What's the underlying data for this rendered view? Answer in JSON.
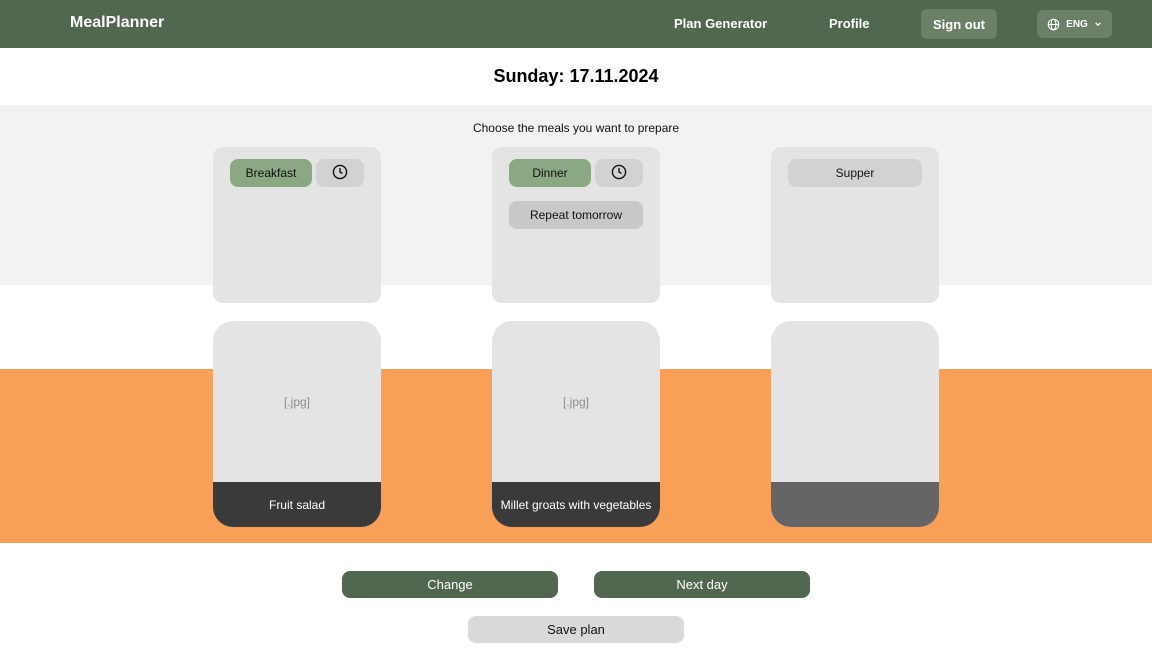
{
  "nav": {
    "logo": "MealPlanner",
    "plan_generator": "Plan Generator",
    "profile": "Profile",
    "sign_out": "Sign out",
    "language": "ENG",
    "language_icon": "globe-icon",
    "language_chevron": "chevron-down-icon"
  },
  "day": {
    "title": "Sunday: 17.11.2024",
    "instruction": "Choose the meals you want to prepare"
  },
  "meals": [
    {
      "label": "Breakfast",
      "active": true,
      "has_time": true,
      "time_icon": "clock-icon",
      "repeat_label": null,
      "image_placeholder": "[.jpg]",
      "dish": "Fruit salad"
    },
    {
      "label": "Dinner",
      "active": true,
      "has_time": true,
      "time_icon": "clock-icon",
      "repeat_label": "Repeat tomorrow",
      "image_placeholder": "[.jpg]",
      "dish": "Millet groats with vegetables"
    },
    {
      "label": "Supper",
      "active": false,
      "has_time": false,
      "repeat_label": null,
      "image_placeholder": "",
      "dish": ""
    }
  ],
  "actions": {
    "change": "Change",
    "next_day": "Next day",
    "save_plan": "Save plan"
  },
  "colors": {
    "navbar": "#526750",
    "accent_green": "#8aa882",
    "orange_band": "#f8a058",
    "grey_band": "#f2f2f2",
    "dish_label": "#3a3a3a"
  }
}
